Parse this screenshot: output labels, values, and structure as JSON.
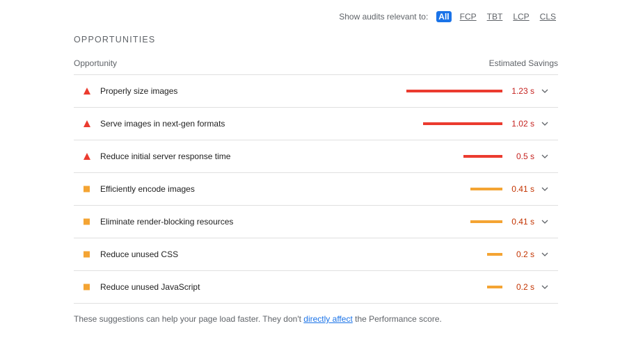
{
  "filter": {
    "label": "Show audits relevant to:",
    "options": [
      "All",
      "FCP",
      "TBT",
      "LCP",
      "CLS"
    ],
    "active": "All"
  },
  "section": {
    "title": "OPPORTUNITIES",
    "column_opportunity": "Opportunity",
    "column_savings": "Estimated Savings"
  },
  "opportunities": [
    {
      "title": "Properly size images",
      "savings": "1.23 s",
      "savings_seconds": 1.23,
      "status": "fail"
    },
    {
      "title": "Serve images in next-gen formats",
      "savings": "1.02 s",
      "savings_seconds": 1.02,
      "status": "fail"
    },
    {
      "title": "Reduce initial server response time",
      "savings": "0.5 s",
      "savings_seconds": 0.5,
      "status": "fail"
    },
    {
      "title": "Efficiently encode images",
      "savings": "0.41 s",
      "savings_seconds": 0.41,
      "status": "average"
    },
    {
      "title": "Eliminate render-blocking resources",
      "savings": "0.41 s",
      "savings_seconds": 0.41,
      "status": "average"
    },
    {
      "title": "Reduce unused CSS",
      "savings": "0.2 s",
      "savings_seconds": 0.2,
      "status": "average"
    },
    {
      "title": "Reduce unused JavaScript",
      "savings": "0.2 s",
      "savings_seconds": 0.2,
      "status": "average"
    }
  ],
  "footer": {
    "prefix": "These suggestions can help your page load faster. They don't ",
    "link": "directly affect",
    "suffix": " the Performance score."
  },
  "colors": {
    "fail": "#eb3b2f",
    "average": "#f4a433",
    "accent": "#1a73e8"
  },
  "icons": {
    "fail": "red-triangle-icon",
    "average": "orange-square-icon",
    "expand": "chevron-down-icon"
  }
}
